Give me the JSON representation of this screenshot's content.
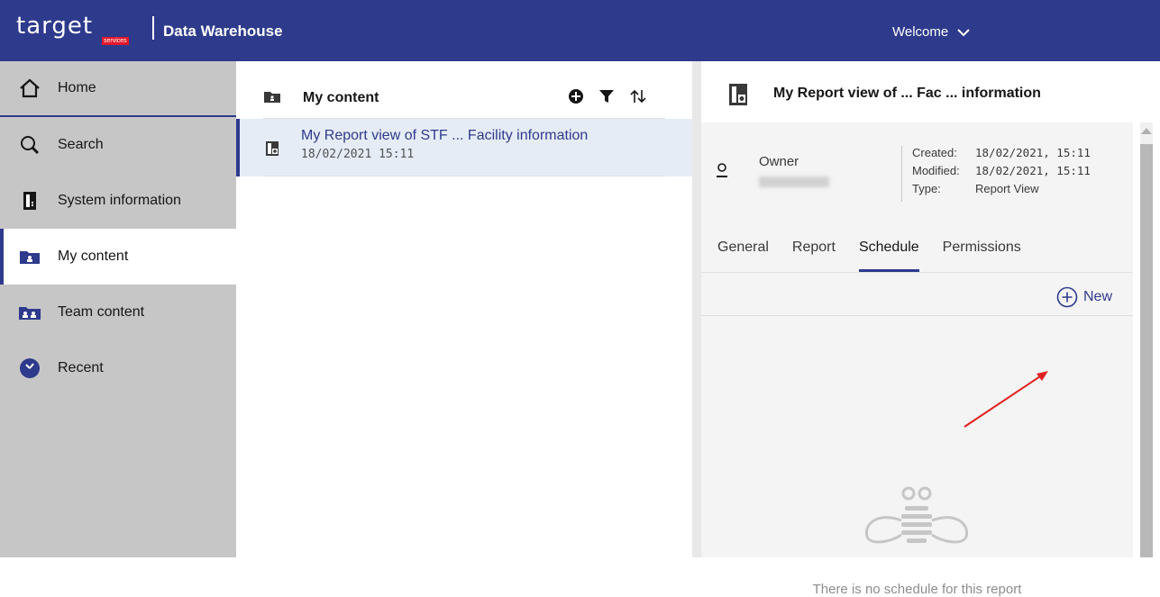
{
  "header": {
    "logo_text": "target",
    "logo_sub": "services",
    "app_title": "Data Warehouse",
    "welcome_label": "Welcome"
  },
  "sidebar": {
    "items": [
      {
        "label": "Home",
        "icon": "home-icon"
      },
      {
        "label": "Search",
        "icon": "search-icon"
      },
      {
        "label": "System information",
        "icon": "system-information-icon"
      },
      {
        "label": "My content",
        "icon": "my-content-folder-icon",
        "active": true
      },
      {
        "label": "Team content",
        "icon": "team-content-folder-icon"
      },
      {
        "label": "Recent",
        "icon": "recent-clock-icon"
      }
    ]
  },
  "content_list": {
    "title": "My content",
    "items": [
      {
        "name": "My Report view of STF ... Facility information",
        "date": "18/02/2021 15:11"
      }
    ]
  },
  "details": {
    "title": "My Report view of ... Fac ... information",
    "owner_label": "Owner",
    "created_label": "Created:",
    "created_value": "18/02/2021, 15:11",
    "modified_label": "Modified:",
    "modified_value": "18/02/2021, 15:11",
    "type_label": "Type:",
    "type_value": "Report View",
    "tabs": [
      "General",
      "Report",
      "Schedule",
      "Permissions"
    ],
    "active_tab": "Schedule",
    "new_label": "New",
    "empty_message": "There is no schedule for this report"
  },
  "colors": {
    "brand": "#2e3a8c",
    "sidebar_bg": "#c6c6c6",
    "selected_row": "#e5ecf5",
    "annotation_arrow": "#e02020"
  }
}
